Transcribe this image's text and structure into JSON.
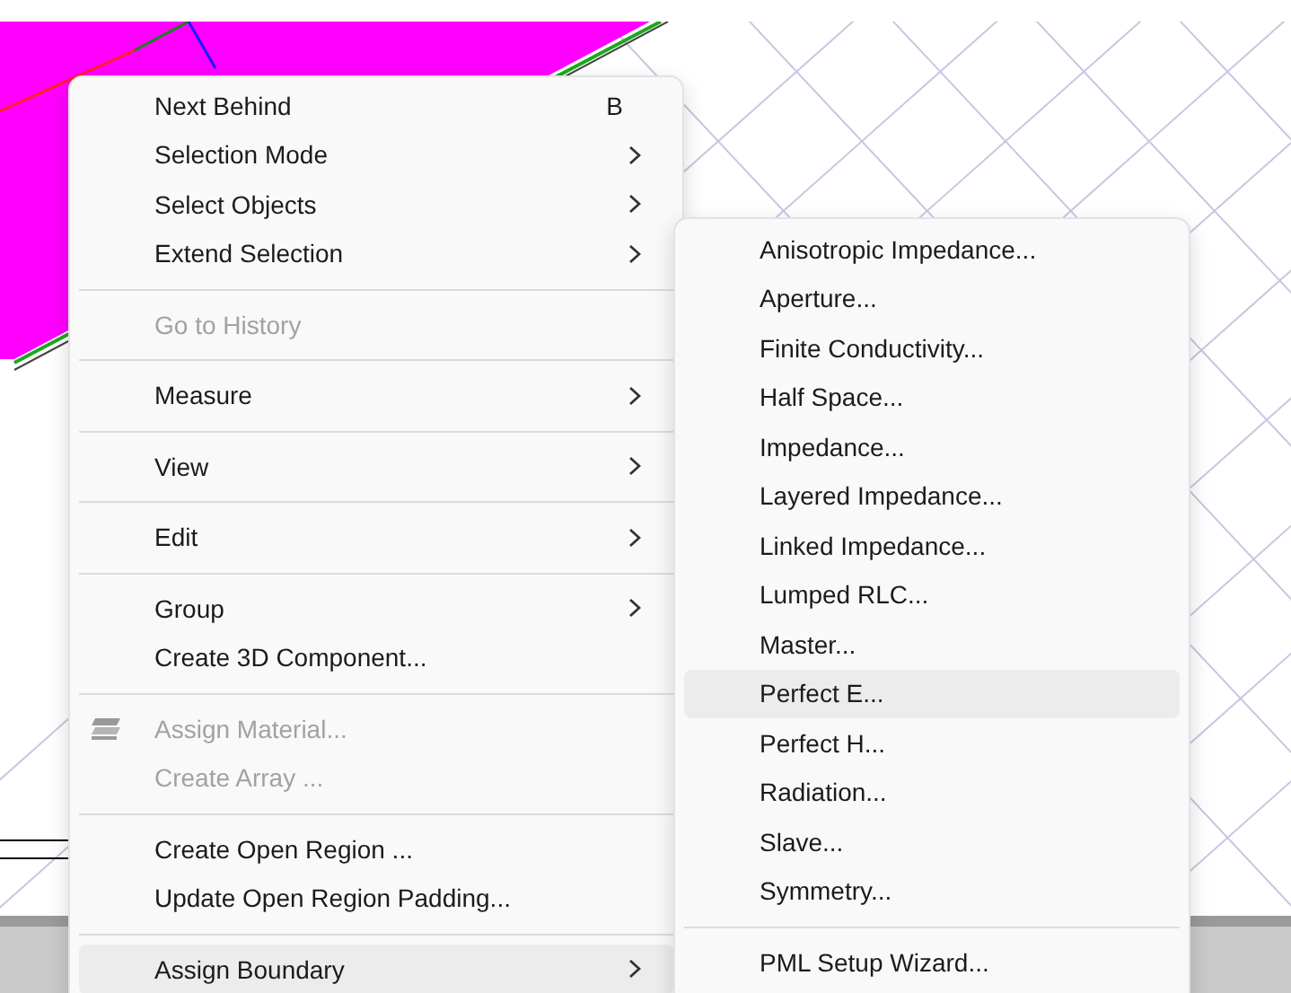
{
  "context_menu": {
    "items": [
      {
        "kind": "item",
        "label": "Next Behind",
        "shortcut": "B",
        "has_submenu": false,
        "disabled": false,
        "selected": false
      },
      {
        "kind": "item",
        "label": "Selection Mode",
        "has_submenu": true,
        "disabled": false,
        "selected": false
      },
      {
        "kind": "item",
        "label": "Select Objects",
        "has_submenu": true,
        "disabled": false,
        "selected": false
      },
      {
        "kind": "item",
        "label": "Extend Selection",
        "has_submenu": true,
        "disabled": false,
        "selected": false
      },
      {
        "kind": "separator"
      },
      {
        "kind": "item",
        "label": "Go to History",
        "has_submenu": false,
        "disabled": true,
        "selected": false
      },
      {
        "kind": "separator"
      },
      {
        "kind": "item",
        "label": "Measure",
        "has_submenu": true,
        "disabled": false,
        "selected": false
      },
      {
        "kind": "separator"
      },
      {
        "kind": "item",
        "label": "View",
        "has_submenu": true,
        "disabled": false,
        "selected": false
      },
      {
        "kind": "separator"
      },
      {
        "kind": "item",
        "label": "Edit",
        "has_submenu": true,
        "disabled": false,
        "selected": false
      },
      {
        "kind": "separator"
      },
      {
        "kind": "item",
        "label": "Group",
        "has_submenu": true,
        "disabled": false,
        "selected": false
      },
      {
        "kind": "item",
        "label": "Create 3D Component...",
        "has_submenu": false,
        "disabled": false,
        "selected": false
      },
      {
        "kind": "separator"
      },
      {
        "kind": "icon_item",
        "label": "Assign Material...",
        "has_submenu": false,
        "disabled": true,
        "selected": false
      },
      {
        "kind": "item",
        "label": "Create Array ...",
        "has_submenu": false,
        "disabled": true,
        "selected": false
      },
      {
        "kind": "separator"
      },
      {
        "kind": "item",
        "label": "Create Open Region ...",
        "has_submenu": false,
        "disabled": false,
        "selected": false
      },
      {
        "kind": "item",
        "label": "Update Open Region Padding...",
        "has_submenu": false,
        "disabled": false,
        "selected": false
      },
      {
        "kind": "separator"
      },
      {
        "kind": "item",
        "label": "Assign Boundary",
        "has_submenu": true,
        "disabled": false,
        "selected": true
      }
    ]
  },
  "submenu": {
    "items": [
      {
        "kind": "item",
        "label": "Anisotropic Impedance...",
        "selected": false
      },
      {
        "kind": "item",
        "label": "Aperture...",
        "selected": false
      },
      {
        "kind": "item",
        "label": "Finite Conductivity...",
        "selected": false
      },
      {
        "kind": "item",
        "label": "Half Space...",
        "selected": false
      },
      {
        "kind": "item",
        "label": "Impedance...",
        "selected": false
      },
      {
        "kind": "item",
        "label": "Layered Impedance...",
        "selected": false
      },
      {
        "kind": "item",
        "label": "Linked Impedance...",
        "selected": false
      },
      {
        "kind": "item",
        "label": "Lumped RLC...",
        "selected": false
      },
      {
        "kind": "item",
        "label": "Master...",
        "selected": false
      },
      {
        "kind": "item",
        "label": "Perfect E...",
        "selected": true
      },
      {
        "kind": "item",
        "label": "Perfect H...",
        "selected": false
      },
      {
        "kind": "item",
        "label": "Radiation...",
        "selected": false
      },
      {
        "kind": "item",
        "label": "Slave...",
        "selected": false
      },
      {
        "kind": "item",
        "label": "Symmetry...",
        "selected": false
      },
      {
        "kind": "separator"
      },
      {
        "kind": "item",
        "label": "PML Setup Wizard...",
        "selected": false
      }
    ]
  }
}
